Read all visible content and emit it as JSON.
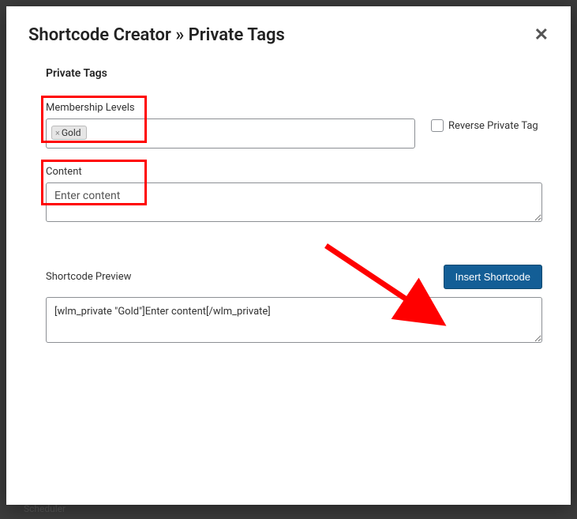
{
  "modal": {
    "title": "Shortcode Creator » Private Tags",
    "section_title": "Private Tags"
  },
  "levels": {
    "label": "Membership Levels",
    "tags": [
      "Gold"
    ]
  },
  "reverse": {
    "label": "Reverse Private Tag",
    "checked": false
  },
  "content": {
    "label": "Content",
    "placeholder": "Enter content",
    "value": "Enter content"
  },
  "preview": {
    "label": "Shortcode Preview",
    "value": "[wlm_private \"Gold\"]Enter content[/wlm_private]"
  },
  "buttons": {
    "insert": "Insert Shortcode"
  },
  "backdrop": {
    "scheduler": "Scheduler"
  }
}
